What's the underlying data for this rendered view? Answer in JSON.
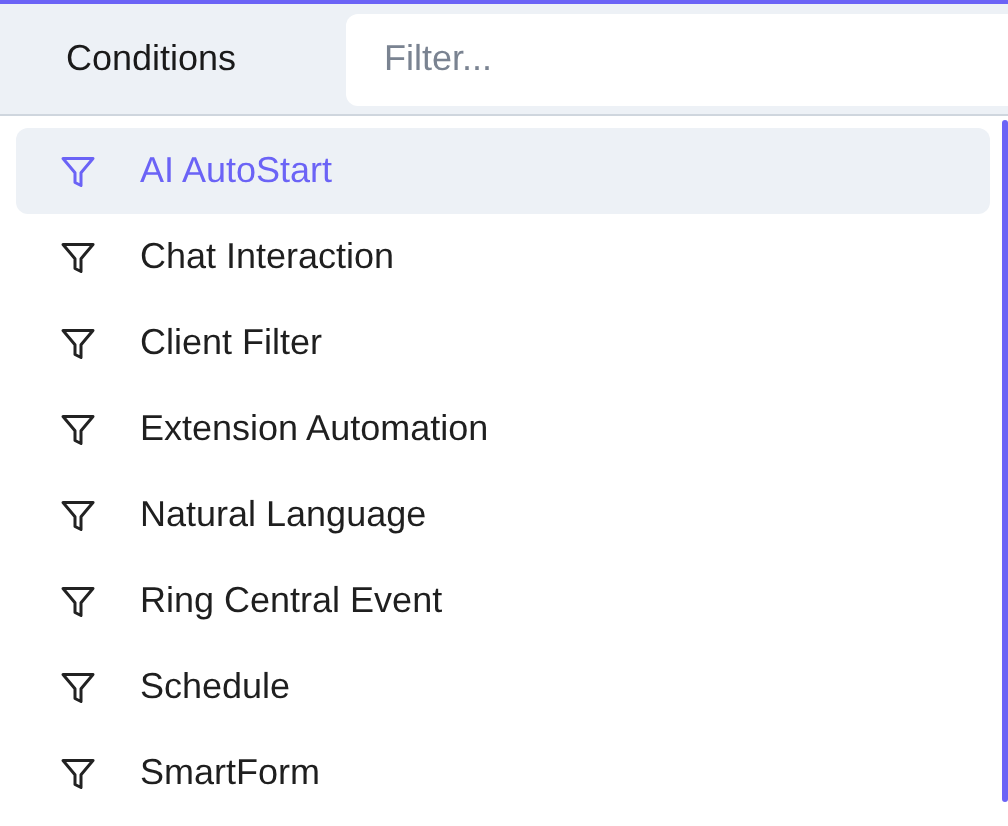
{
  "header": {
    "title": "Conditions",
    "filter": {
      "placeholder": "Filter..."
    }
  },
  "items": [
    {
      "label": "AI AutoStart",
      "highlighted": true
    },
    {
      "label": "Chat Interaction",
      "highlighted": false
    },
    {
      "label": "Client Filter",
      "highlighted": false
    },
    {
      "label": "Extension Automation",
      "highlighted": false
    },
    {
      "label": "Natural Language",
      "highlighted": false
    },
    {
      "label": "Ring Central Event",
      "highlighted": false
    },
    {
      "label": "Schedule",
      "highlighted": false
    },
    {
      "label": "SmartForm",
      "highlighted": false
    }
  ]
}
